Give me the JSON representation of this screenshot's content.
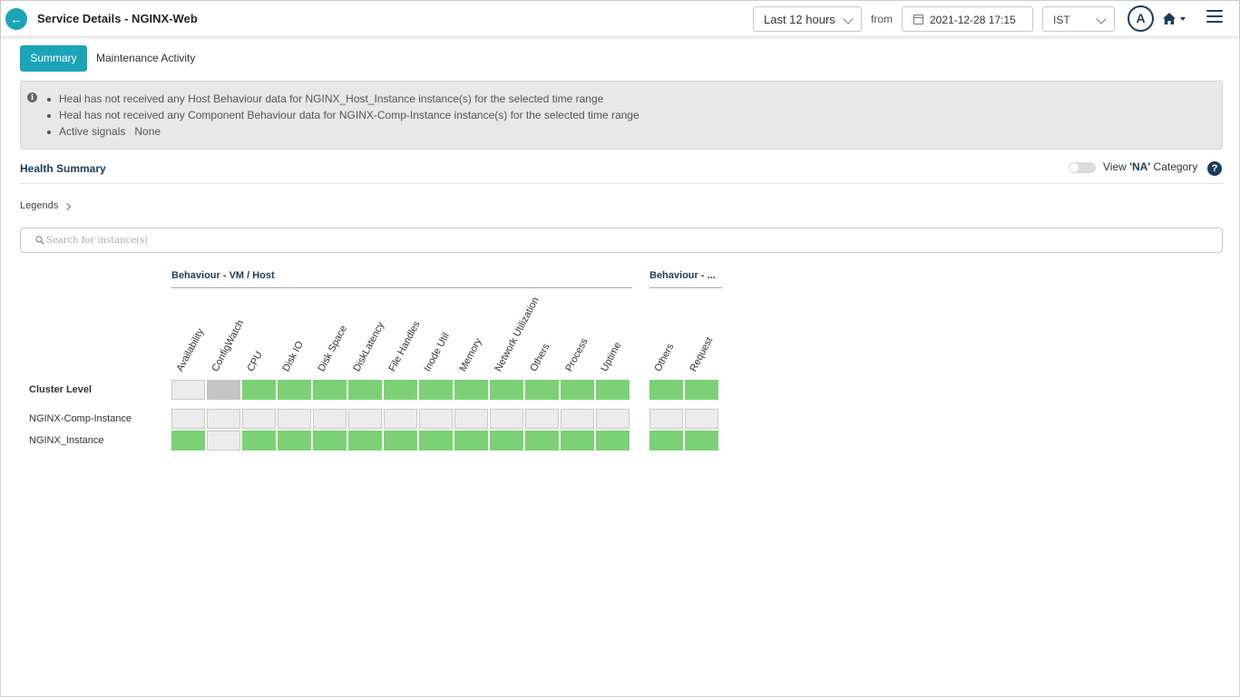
{
  "header": {
    "title": "Service Details - NGINX-Web",
    "time_range": "Last 12 hours",
    "from_label": "from",
    "from_date": "2021-12-28 17:15",
    "timezone": "IST",
    "avatar_initial": "A"
  },
  "tabs": [
    {
      "label": "Summary",
      "active": true
    },
    {
      "label": "Maintenance Activity",
      "active": false
    }
  ],
  "info": {
    "lines": [
      "Heal has not received any Host Behaviour data for NGINX_Host_Instance instance(s) for the selected time range",
      "Heal has not received any Component Behaviour data for NGINX-Comp-Instance instance(s) for the selected time range",
      "Active signals   None"
    ]
  },
  "health": {
    "title": "Health Summary",
    "toggle_label_pre": "View ",
    "toggle_label_bold": "'NA'",
    "toggle_label_post": " Category",
    "toggle_on": false,
    "legends_label": "Legends",
    "search_placeholder": "Search for instance(s)"
  },
  "grid": {
    "groups": [
      {
        "title": "Behaviour - VM / Host",
        "columns": [
          "Availability",
          "ConfigWatch",
          "CPU",
          "Disk IO",
          "Disk Space",
          "DiskLatency",
          "File Handles",
          "Inode Util",
          "Memory",
          "Network Utilization",
          "Others",
          "Process",
          "Uptime"
        ]
      },
      {
        "title": "Behaviour - ...",
        "columns": [
          "Others",
          "Request"
        ]
      }
    ],
    "rows": [
      {
        "label": "Cluster Level",
        "bold": true,
        "cells": [
          "light",
          "dark",
          "green",
          "green",
          "green",
          "green",
          "green",
          "green",
          "green",
          "green",
          "green",
          "green",
          "green",
          "green",
          "green"
        ]
      },
      {
        "label": "NGINX-Comp-Instance",
        "bold": false,
        "cells": [
          "light",
          "light",
          "light",
          "light",
          "light",
          "light",
          "light",
          "light",
          "light",
          "light",
          "light",
          "light",
          "light",
          "light",
          "light"
        ]
      },
      {
        "label": "NGINX_Instance",
        "bold": false,
        "cells": [
          "green",
          "light",
          "green",
          "green",
          "green",
          "green",
          "green",
          "green",
          "green",
          "green",
          "green",
          "green",
          "green",
          "green",
          "green"
        ]
      }
    ],
    "status_colors": {
      "green": "#7bd174",
      "light": "#ececec",
      "dark": "#c4c4c4"
    }
  },
  "colors": {
    "accent": "#1ba3b8",
    "navy": "#1c3d5a"
  },
  "icons": [
    "back-arrow-icon",
    "chevron-down-icon",
    "calendar-icon",
    "home-icon",
    "hamburger-menu-icon",
    "info-icon",
    "help-icon",
    "chevron-right-icon",
    "search-icon"
  ]
}
